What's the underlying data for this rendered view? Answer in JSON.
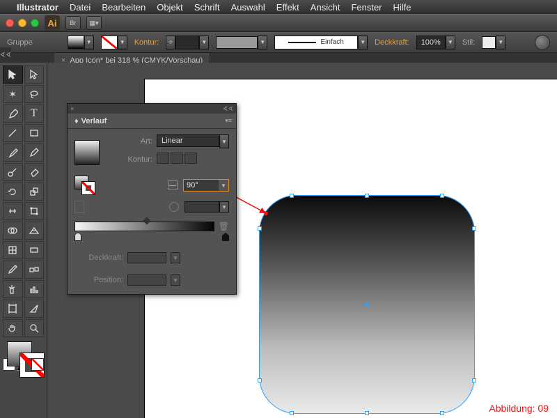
{
  "menubar": {
    "app": "Illustrator",
    "items": [
      "Datei",
      "Bearbeiten",
      "Objekt",
      "Schrift",
      "Auswahl",
      "Effekt",
      "Ansicht",
      "Fenster",
      "Hilfe"
    ]
  },
  "app_logo": "Ai",
  "br_label": "Br",
  "controlbar": {
    "selection": "Gruppe",
    "kontur_label": "Kontur:",
    "stroke_profile": "Einfach",
    "opacity_label": "Deckkraft:",
    "opacity_value": "100%",
    "stil_label": "Stil:"
  },
  "doctab": {
    "close": "×",
    "title": "App Icon* bei 318 % (CMYK/Vorschau)"
  },
  "panel": {
    "title": "Verlauf",
    "art_label": "Art:",
    "art_value": "Linear",
    "kontur_label": "Kontur:",
    "angle_value": "90°",
    "opacity_label": "Deckkraft:",
    "position_label": "Position:"
  },
  "caption": "Abbildung: 09",
  "colors": {
    "select": "#2aa3ff",
    "highlight": "#dd8b1f"
  }
}
